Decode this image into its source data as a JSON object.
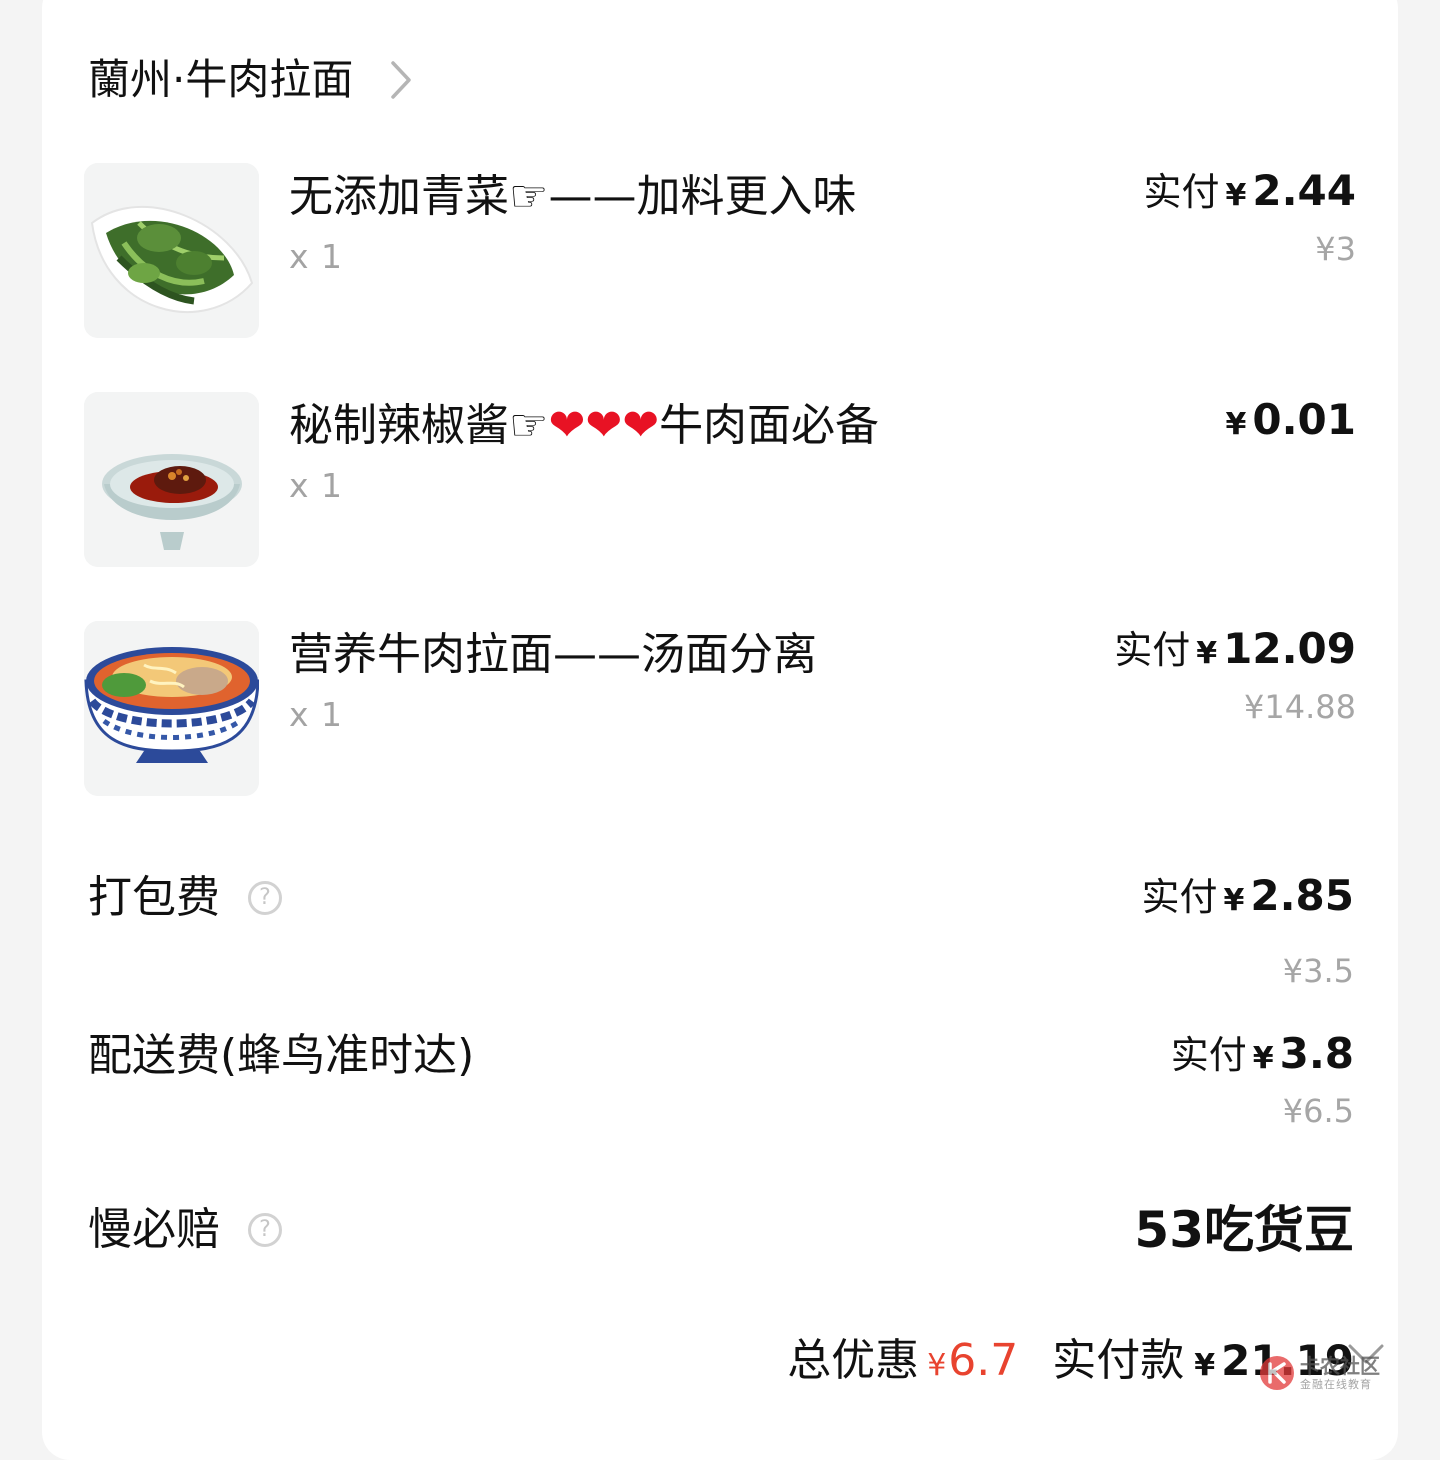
{
  "shop": {
    "name": "蘭州·牛肉拉面"
  },
  "items": [
    {
      "name": "无添加青菜☞——加料更入味",
      "qty": "x 1",
      "paid_label": "实付",
      "currency": "¥",
      "paid": "2.44",
      "original": "¥3",
      "image": "greens-bowl"
    },
    {
      "name_pre": "秘制辣椒酱☞",
      "hearts": "❤❤❤",
      "name_post": "牛肉面必备",
      "qty": "x 1",
      "paid_label": "",
      "currency": "¥",
      "paid": "0.01",
      "original": "",
      "image": "chili-sauce-bowl"
    },
    {
      "name": "营养牛肉拉面——汤面分离",
      "qty": "x 1",
      "paid_label": "实付",
      "currency": "¥",
      "paid": "12.09",
      "original": "¥14.88",
      "image": "beef-noodle-bowl"
    }
  ],
  "fees": {
    "packing": {
      "label": "打包费",
      "paid_label": "实付",
      "currency": "¥",
      "paid": "2.85",
      "original": "¥3.5",
      "icon": "help-circle-icon"
    },
    "delivery": {
      "label": "配送费(蜂鸟准时达)",
      "paid_label": "实付",
      "currency": "¥",
      "paid": "3.8",
      "original": "¥6.5"
    },
    "late_compensation": {
      "label": "慢必赔",
      "value": "53吃货豆",
      "icon": "help-circle-icon"
    }
  },
  "summary": {
    "discount_label": "总优惠",
    "discount_currency": "¥",
    "discount": "6.7",
    "paid_label": "实付款",
    "paid_currency": "¥",
    "paid": "21.19"
  },
  "watermark": {
    "main": "卡农社区",
    "sub": "金融在线教育"
  },
  "colors": {
    "accent_red": "#e8432f",
    "heart": "#e81224",
    "muted": "#a6a6a6"
  }
}
